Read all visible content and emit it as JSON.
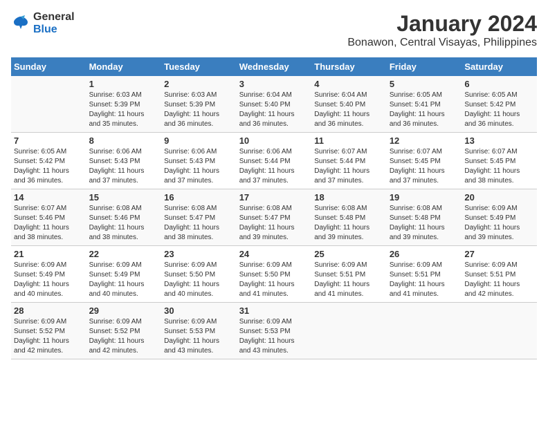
{
  "logo": {
    "line1": "General",
    "line2": "Blue"
  },
  "title": "January 2024",
  "subtitle": "Bonawon, Central Visayas, Philippines",
  "days_of_week": [
    "Sunday",
    "Monday",
    "Tuesday",
    "Wednesday",
    "Thursday",
    "Friday",
    "Saturday"
  ],
  "weeks": [
    [
      {
        "day": "",
        "info": ""
      },
      {
        "day": "1",
        "info": "Sunrise: 6:03 AM\nSunset: 5:39 PM\nDaylight: 11 hours\nand 35 minutes."
      },
      {
        "day": "2",
        "info": "Sunrise: 6:03 AM\nSunset: 5:39 PM\nDaylight: 11 hours\nand 36 minutes."
      },
      {
        "day": "3",
        "info": "Sunrise: 6:04 AM\nSunset: 5:40 PM\nDaylight: 11 hours\nand 36 minutes."
      },
      {
        "day": "4",
        "info": "Sunrise: 6:04 AM\nSunset: 5:40 PM\nDaylight: 11 hours\nand 36 minutes."
      },
      {
        "day": "5",
        "info": "Sunrise: 6:05 AM\nSunset: 5:41 PM\nDaylight: 11 hours\nand 36 minutes."
      },
      {
        "day": "6",
        "info": "Sunrise: 6:05 AM\nSunset: 5:42 PM\nDaylight: 11 hours\nand 36 minutes."
      }
    ],
    [
      {
        "day": "7",
        "info": "Sunrise: 6:05 AM\nSunset: 5:42 PM\nDaylight: 11 hours\nand 36 minutes."
      },
      {
        "day": "8",
        "info": "Sunrise: 6:06 AM\nSunset: 5:43 PM\nDaylight: 11 hours\nand 37 minutes."
      },
      {
        "day": "9",
        "info": "Sunrise: 6:06 AM\nSunset: 5:43 PM\nDaylight: 11 hours\nand 37 minutes."
      },
      {
        "day": "10",
        "info": "Sunrise: 6:06 AM\nSunset: 5:44 PM\nDaylight: 11 hours\nand 37 minutes."
      },
      {
        "day": "11",
        "info": "Sunrise: 6:07 AM\nSunset: 5:44 PM\nDaylight: 11 hours\nand 37 minutes."
      },
      {
        "day": "12",
        "info": "Sunrise: 6:07 AM\nSunset: 5:45 PM\nDaylight: 11 hours\nand 37 minutes."
      },
      {
        "day": "13",
        "info": "Sunrise: 6:07 AM\nSunset: 5:45 PM\nDaylight: 11 hours\nand 38 minutes."
      }
    ],
    [
      {
        "day": "14",
        "info": "Sunrise: 6:07 AM\nSunset: 5:46 PM\nDaylight: 11 hours\nand 38 minutes."
      },
      {
        "day": "15",
        "info": "Sunrise: 6:08 AM\nSunset: 5:46 PM\nDaylight: 11 hours\nand 38 minutes."
      },
      {
        "day": "16",
        "info": "Sunrise: 6:08 AM\nSunset: 5:47 PM\nDaylight: 11 hours\nand 38 minutes."
      },
      {
        "day": "17",
        "info": "Sunrise: 6:08 AM\nSunset: 5:47 PM\nDaylight: 11 hours\nand 39 minutes."
      },
      {
        "day": "18",
        "info": "Sunrise: 6:08 AM\nSunset: 5:48 PM\nDaylight: 11 hours\nand 39 minutes."
      },
      {
        "day": "19",
        "info": "Sunrise: 6:08 AM\nSunset: 5:48 PM\nDaylight: 11 hours\nand 39 minutes."
      },
      {
        "day": "20",
        "info": "Sunrise: 6:09 AM\nSunset: 5:49 PM\nDaylight: 11 hours\nand 39 minutes."
      }
    ],
    [
      {
        "day": "21",
        "info": "Sunrise: 6:09 AM\nSunset: 5:49 PM\nDaylight: 11 hours\nand 40 minutes."
      },
      {
        "day": "22",
        "info": "Sunrise: 6:09 AM\nSunset: 5:49 PM\nDaylight: 11 hours\nand 40 minutes."
      },
      {
        "day": "23",
        "info": "Sunrise: 6:09 AM\nSunset: 5:50 PM\nDaylight: 11 hours\nand 40 minutes."
      },
      {
        "day": "24",
        "info": "Sunrise: 6:09 AM\nSunset: 5:50 PM\nDaylight: 11 hours\nand 41 minutes."
      },
      {
        "day": "25",
        "info": "Sunrise: 6:09 AM\nSunset: 5:51 PM\nDaylight: 11 hours\nand 41 minutes."
      },
      {
        "day": "26",
        "info": "Sunrise: 6:09 AM\nSunset: 5:51 PM\nDaylight: 11 hours\nand 41 minutes."
      },
      {
        "day": "27",
        "info": "Sunrise: 6:09 AM\nSunset: 5:51 PM\nDaylight: 11 hours\nand 42 minutes."
      }
    ],
    [
      {
        "day": "28",
        "info": "Sunrise: 6:09 AM\nSunset: 5:52 PM\nDaylight: 11 hours\nand 42 minutes."
      },
      {
        "day": "29",
        "info": "Sunrise: 6:09 AM\nSunset: 5:52 PM\nDaylight: 11 hours\nand 42 minutes."
      },
      {
        "day": "30",
        "info": "Sunrise: 6:09 AM\nSunset: 5:53 PM\nDaylight: 11 hours\nand 43 minutes."
      },
      {
        "day": "31",
        "info": "Sunrise: 6:09 AM\nSunset: 5:53 PM\nDaylight: 11 hours\nand 43 minutes."
      },
      {
        "day": "",
        "info": ""
      },
      {
        "day": "",
        "info": ""
      },
      {
        "day": "",
        "info": ""
      }
    ]
  ]
}
